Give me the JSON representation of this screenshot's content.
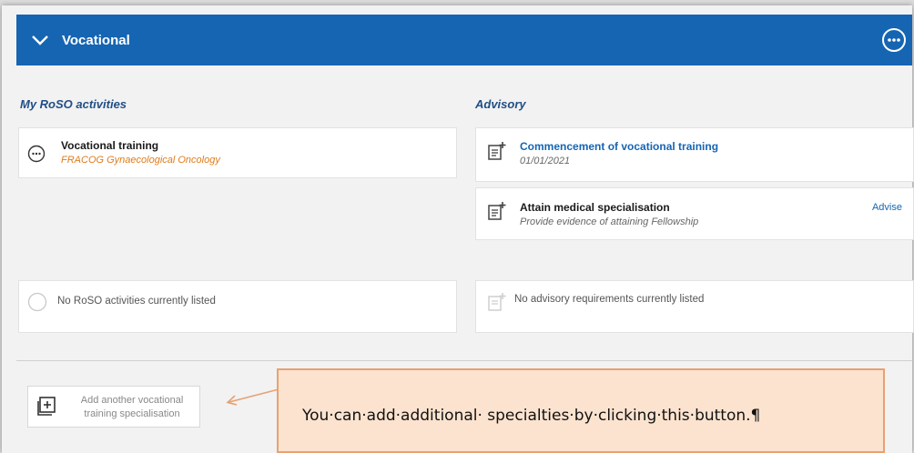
{
  "header": {
    "title": "Vocational"
  },
  "sections": {
    "left_title": "My RoSO activities",
    "right_title": "Advisory"
  },
  "left_cards": {
    "vocational_training": {
      "title": "Vocational training",
      "subtitle": "FRACOG Gynaecological Oncology"
    },
    "empty": {
      "text": "No RoSO activities currently listed"
    }
  },
  "right_cards": {
    "commencement": {
      "title": "Commencement of vocational training",
      "subtitle": "01/01/2021"
    },
    "attain": {
      "title": "Attain medical specialisation",
      "subtitle": "Provide evidence of attaining Fellowship",
      "action": "Advise"
    },
    "empty": {
      "text": "No advisory requirements currently listed"
    }
  },
  "add_button": {
    "label": "Add another vocational training specialisation"
  },
  "callout": {
    "text": "You·can·add·additional· specialties·by·clicking·this·button.¶"
  },
  "colors": {
    "header_bg": "#1565b3",
    "link": "#1565b3",
    "orange_sub": "#e07b1a",
    "callout_bg": "#fbe3cf",
    "callout_border": "#e8a173"
  },
  "icons": {
    "header_toggle": "chevron-down-icon",
    "header_menu": "more-options-icon",
    "training": "ellipsis-circle-icon",
    "advisory": "document-plus-icon",
    "add": "add-square-icon"
  }
}
